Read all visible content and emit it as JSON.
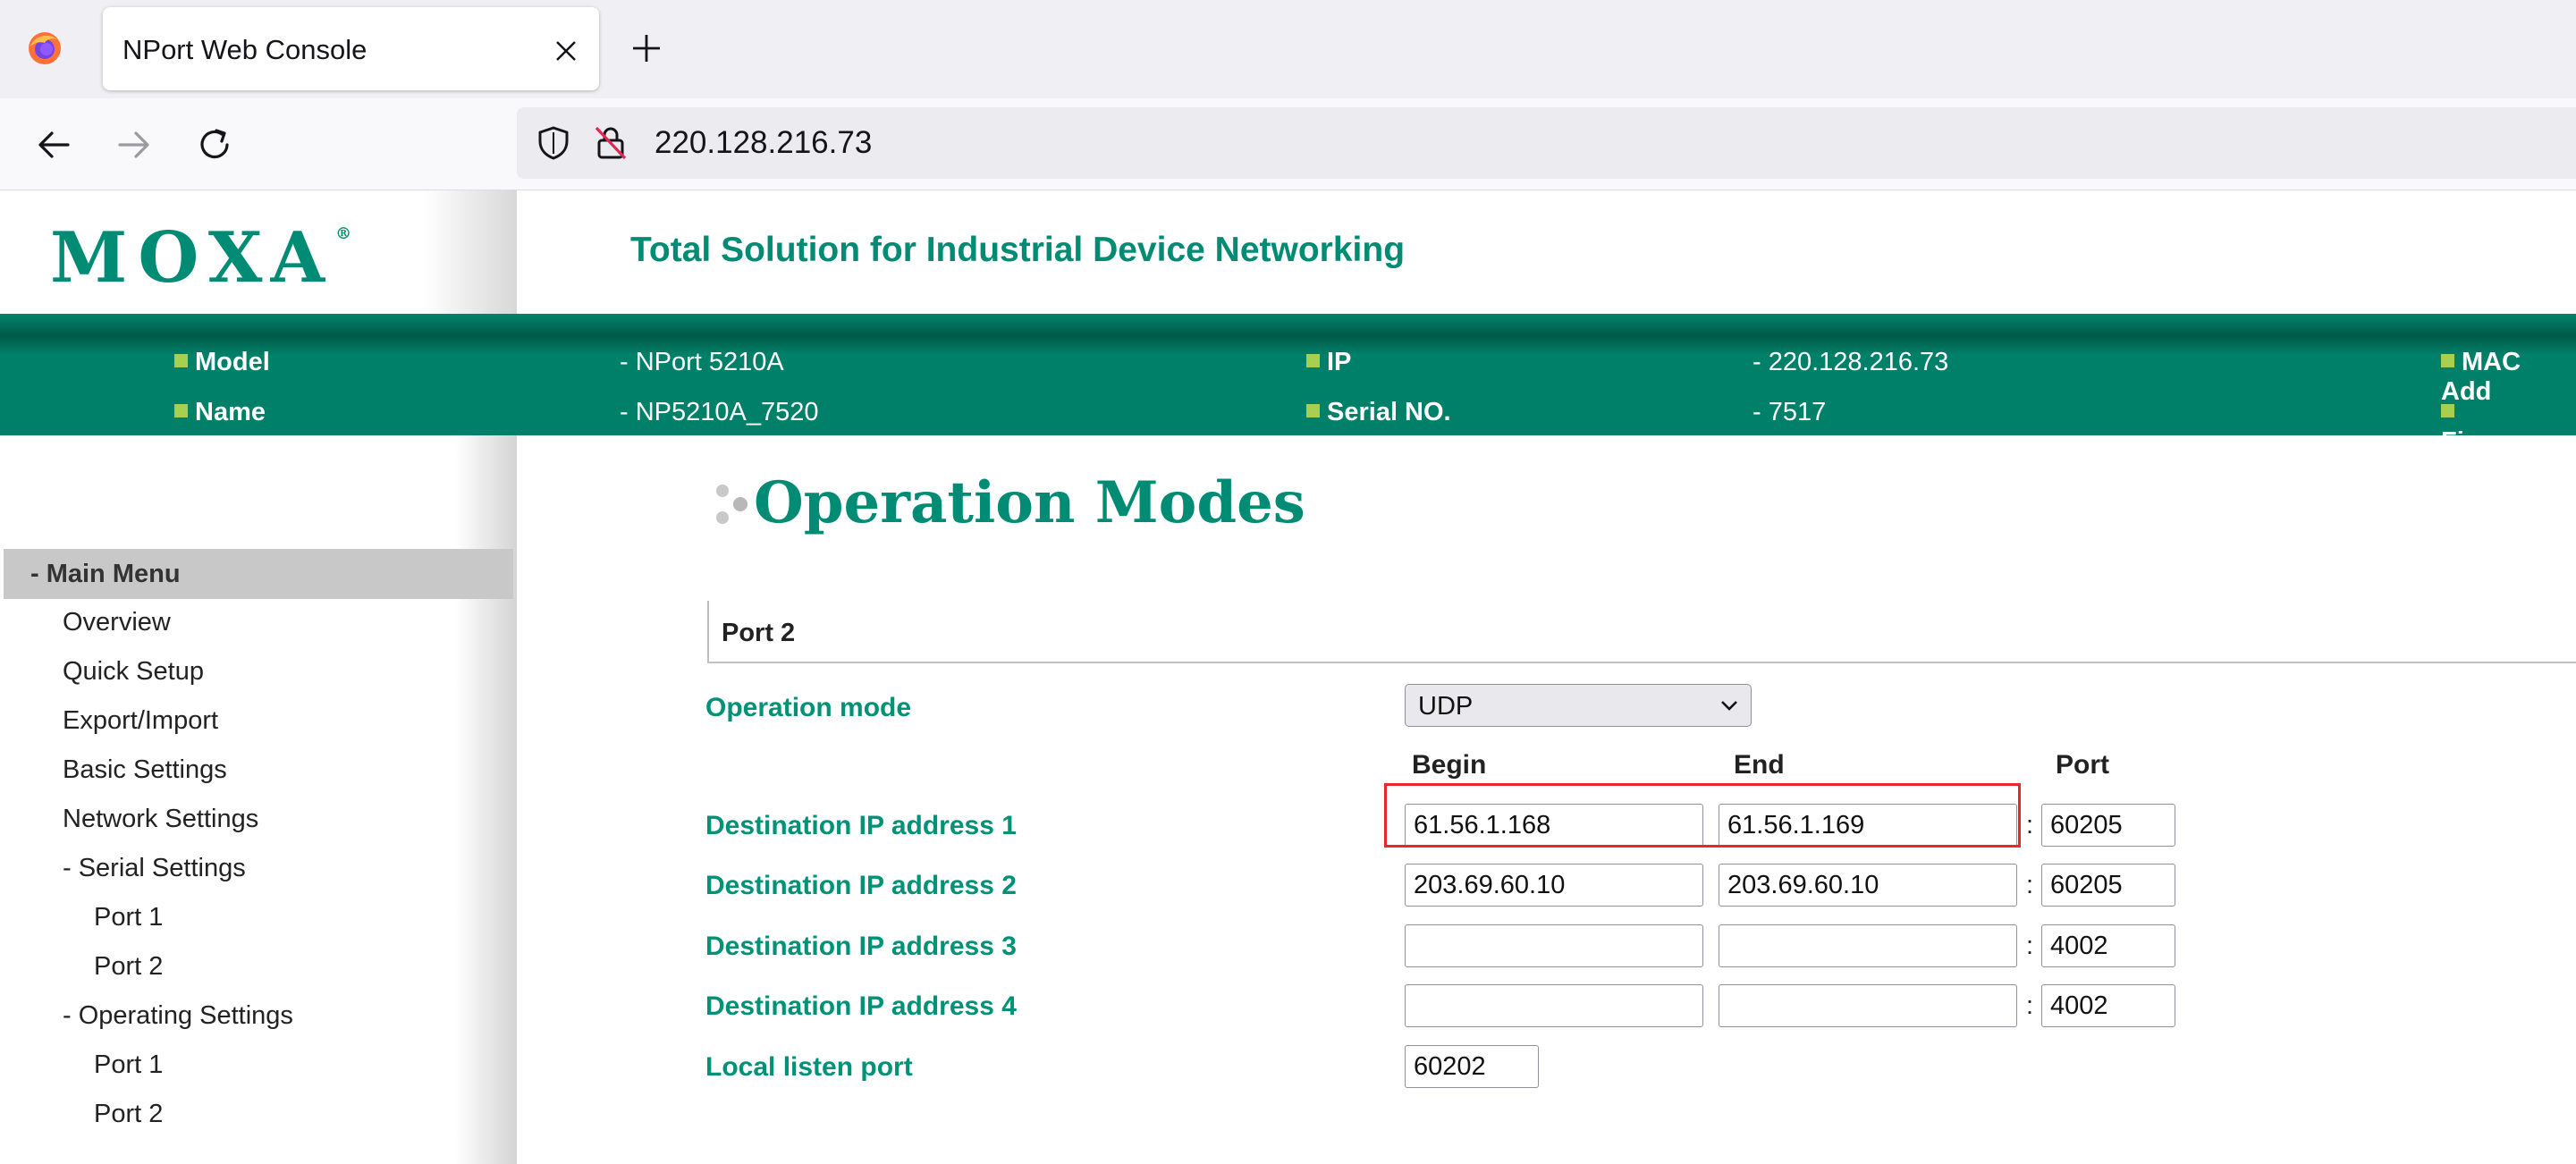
{
  "browser": {
    "tab_title": "NPort Web Console",
    "url": "220.128.216.73"
  },
  "header": {
    "logo": "MOXA",
    "tagline": "Total Solution for Industrial Device Networking"
  },
  "info": {
    "model_label": "Model",
    "model_value": "- NPort 5210A",
    "name_label": "Name",
    "name_value": "- NP5210A_7520",
    "ip_label": "IP",
    "ip_value": "- 220.128.216.73",
    "serial_label": "Serial NO.",
    "serial_value": "- 7517",
    "mac_label": "MAC Add",
    "firmware_label": "Firmware"
  },
  "sidebar": {
    "main_menu": "- Main Menu",
    "items": [
      {
        "label": "Overview"
      },
      {
        "label": "Quick Setup"
      },
      {
        "label": "Export/Import"
      },
      {
        "label": "Basic Settings"
      },
      {
        "label": "Network Settings"
      },
      {
        "label": "- Serial Settings"
      },
      {
        "label": "Port 1"
      },
      {
        "label": "Port 2"
      },
      {
        "label": "- Operating Settings"
      },
      {
        "label": "Port 1"
      },
      {
        "label": "Port 2"
      }
    ]
  },
  "main": {
    "title": "Operation Modes",
    "section": "Port 2",
    "op_mode_label": "Operation mode",
    "op_mode_value": "UDP",
    "col_begin": "Begin",
    "col_end": "End",
    "col_port": "Port",
    "colon": ":",
    "destinations": [
      {
        "label": "Destination IP address 1",
        "begin": "61.56.1.168",
        "end": "61.56.1.169",
        "port": "60205"
      },
      {
        "label": "Destination IP address 2",
        "begin": "203.69.60.10",
        "end": "203.69.60.10",
        "port": "60205"
      },
      {
        "label": "Destination IP address 3",
        "begin": "",
        "end": "",
        "port": "4002"
      },
      {
        "label": "Destination IP address 4",
        "begin": "",
        "end": "",
        "port": "4002"
      }
    ],
    "local_port_label": "Local listen port",
    "local_port_value": "60202"
  },
  "colors": {
    "brand_green": "#008c74",
    "infobar_green": "#008068",
    "highlight_red": "#e8262b"
  }
}
